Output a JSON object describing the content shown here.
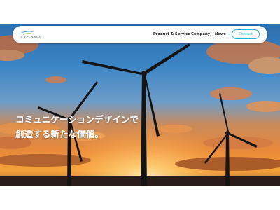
{
  "logo": {
    "name": "KAZENAVA",
    "icon": "wind-logo-icon",
    "colors": {
      "top": "#3cb4c8",
      "bottom": "#8cc63e"
    }
  },
  "nav": {
    "items": [
      {
        "label": "Product & Service"
      },
      {
        "label": "Company"
      },
      {
        "label": "News"
      }
    ],
    "contact_label": "Contact"
  },
  "hero": {
    "line1": "コミュニケーションデザインで",
    "line2": "創造する新たな価値。",
    "image": "wind-turbines-at-sunset"
  },
  "colors": {
    "accent": "#18b5d0",
    "nav_text": "#1a1a1a"
  }
}
